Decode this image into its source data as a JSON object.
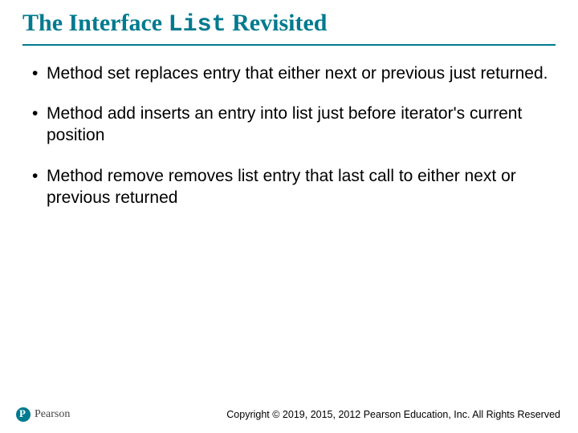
{
  "title": {
    "pre": "The Interface ",
    "mono": "List",
    "post": " Revisited"
  },
  "bullets": [
    "Method set replaces entry that either next or previous just returned.",
    "Method add inserts an entry into list just before iterator's current position",
    "Method remove removes list entry that last call to either next or previous returned"
  ],
  "footer": {
    "brand": "Pearson",
    "copyright": "Copyright © 2019, 2015, 2012 Pearson Education, Inc. All Rights Reserved"
  }
}
